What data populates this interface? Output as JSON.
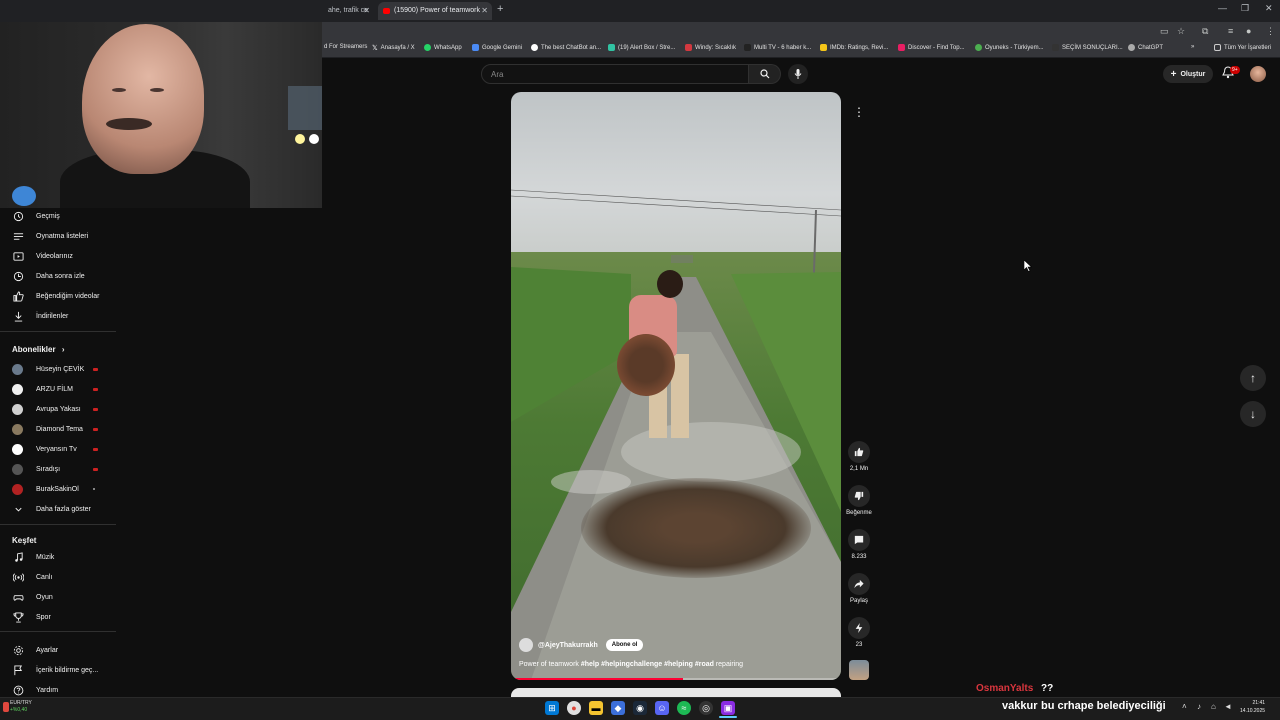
{
  "browser": {
    "tabs": [
      {
        "label": "ahe, trafik ce"
      },
      {
        "label": "(15900) Power of teamwork"
      }
    ],
    "bookmarks": [
      {
        "label": "d For Streamers",
        "color": "#555555"
      },
      {
        "label": "Anasayfa / X",
        "color": "#000000"
      },
      {
        "label": "WhatsApp",
        "color": "#25d366"
      },
      {
        "label": "Google Gemini",
        "color": "#4b8bf5"
      },
      {
        "label": "The best ChatBot an...",
        "color": "#ffffff"
      },
      {
        "label": "(19) Alert Box / Stre...",
        "color": "#31c3a2"
      },
      {
        "label": "Windy: Sıcaklık",
        "color": "#d3383f"
      },
      {
        "label": "Multi TV - 6 haber k...",
        "color": "#222222"
      },
      {
        "label": "IMDb: Ratings, Revi...",
        "color": "#f5c518"
      },
      {
        "label": "Discover - Find Top...",
        "color": "#e91e63"
      },
      {
        "label": "Oyuneks - Türkiyem...",
        "color": "#4caf50"
      },
      {
        "label": "SEÇİM SONUÇLARI...",
        "color": "#333333"
      },
      {
        "label": "ChatGPT",
        "color": "#aaaaaa"
      }
    ],
    "all_bookmarks": "Tüm Yer İşaretleri"
  },
  "header": {
    "search_placeholder": "Ara",
    "create_label": "Oluştur",
    "notification_count": "9+"
  },
  "sidebar": {
    "you_items": [
      {
        "label": "Geçmiş",
        "icon": "history-icon"
      },
      {
        "label": "Oynatma listeleri",
        "icon": "playlist-icon"
      },
      {
        "label": "Videolarınız",
        "icon": "your-videos-icon"
      },
      {
        "label": "Daha sonra izle",
        "icon": "watch-later-icon"
      },
      {
        "label": "Beğendiğim videolar",
        "icon": "thumbs-up-icon"
      },
      {
        "label": "İndirilenler",
        "icon": "download-icon"
      }
    ],
    "subscriptions_title": "Abonelikler",
    "subscriptions": [
      {
        "label": "Hüseyin ÇEVİK",
        "color": "#6a7a8c",
        "live": true
      },
      {
        "label": "ARZU FİLM",
        "color": "#f0f0f0",
        "live": true
      },
      {
        "label": "Avrupa Yakası",
        "color": "#d0d0d0",
        "live": true
      },
      {
        "label": "Diamond Tema",
        "color": "#8a7a60",
        "live": true
      },
      {
        "label": "Veryansın Tv",
        "color": "#ffffff",
        "live": true
      },
      {
        "label": "Sıradışı",
        "color": "#555555",
        "live": true
      },
      {
        "label": "BurakSakinOl",
        "color": "#b22222",
        "live": false
      }
    ],
    "show_more": "Daha fazla göster",
    "explore_title": "Keşfet",
    "explore": [
      {
        "label": "Müzik",
        "icon": "music-icon"
      },
      {
        "label": "Canlı",
        "icon": "live-icon"
      },
      {
        "label": "Oyun",
        "icon": "gaming-icon"
      },
      {
        "label": "Spor",
        "icon": "trophy-icon"
      }
    ],
    "settings": [
      {
        "label": "Ayarlar",
        "icon": "gear-icon"
      },
      {
        "label": "İçerik bildirme geç...",
        "icon": "flag-icon"
      },
      {
        "label": "Yardım",
        "icon": "help-icon"
      }
    ]
  },
  "short": {
    "channel": "@AjeyThakurrakh",
    "subscribe": "Abone ol",
    "caption_plain": "Power of teamwork ",
    "caption_tags": "#help #helpingchallenge #helping #road",
    "caption_tail": " repairing",
    "progress": 0.52,
    "like_count": "2,1 Mn",
    "dislike_label": "Beğenme",
    "comment_count": "8.233",
    "share_label": "Paylaş",
    "remix_count": "23"
  },
  "chat": [
    {
      "user": "OsmanYalts",
      "message": "??",
      "user_color": "#d9363e"
    },
    {
      "user": "vakkur",
      "message": "bu crhape belediyeciliği",
      "user_color": "#ffffff"
    }
  ],
  "taskbar": {
    "ticker_label": "EUR/TRY",
    "ticker_value": "+%0,40",
    "time": "21:41",
    "date": "14.10.2025"
  }
}
